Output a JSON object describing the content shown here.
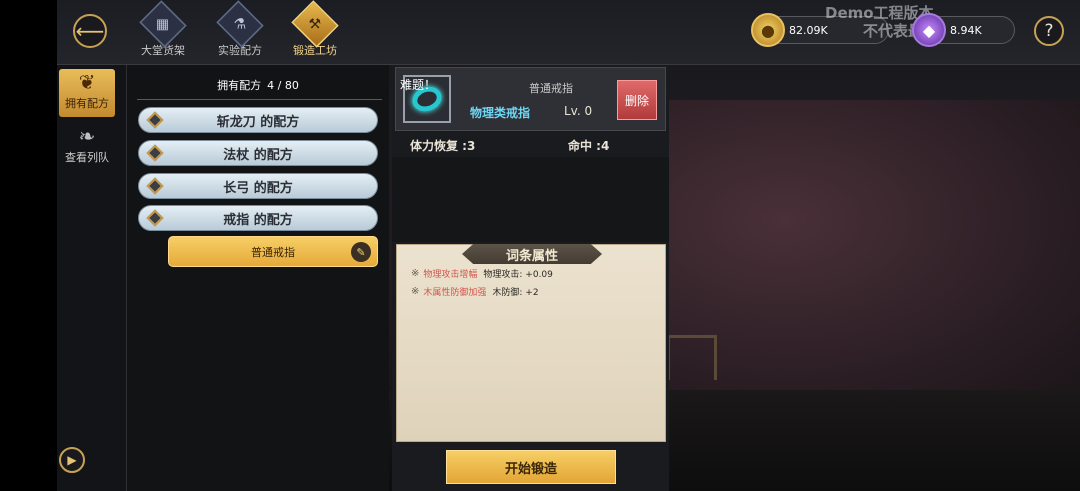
{
  "topbar": {
    "tabs": [
      {
        "label": "大堂货架",
        "icon": "shelf-icon"
      },
      {
        "label": "实验配方",
        "icon": "flask-icon"
      },
      {
        "label": "锻造工坊",
        "icon": "anvil-icon",
        "active": true
      }
    ],
    "watermark": {
      "line1": "Demo工程版本",
      "line2": "不代表最终品质"
    },
    "gold": {
      "value": "82.09K",
      "icon": "gold-coin-icon"
    },
    "gems": {
      "value": "8.94K",
      "icon": "purple-gem-icon"
    },
    "help": "?"
  },
  "sidenav": {
    "items": [
      {
        "label": "拥有配方",
        "icon": "recipe-scroll-icon",
        "active": true
      },
      {
        "label": "查看列队",
        "icon": "queue-icon"
      }
    ]
  },
  "recipes": {
    "count_label": "拥有配方",
    "count_value": "4 / 80",
    "list": [
      {
        "label": "斩龙刀 的配方"
      },
      {
        "label": "法杖 的配方"
      },
      {
        "label": "长弓 的配方"
      },
      {
        "label": "戒指 的配方"
      }
    ],
    "selected_sub": "普通戒指"
  },
  "detail": {
    "tag": "难题！",
    "name": "普通戒指",
    "type": "物理类戒指",
    "level": "Lv. 0",
    "delete_label": "删除",
    "stats": [
      {
        "label": "体力恢复 :3"
      },
      {
        "label": "命中 :4"
      }
    ]
  },
  "affix": {
    "title": "词条属性",
    "lines": [
      {
        "mark": "※",
        "name": "物理攻击增幅",
        "value": "物理攻击: +0.09"
      },
      {
        "mark": "※",
        "name": "木属性防御加强",
        "value": "木防御: +2"
      }
    ]
  },
  "forge_button": "开始锻造",
  "colors": {
    "accent": "#e9bd5a",
    "affix_name": "#d1564c",
    "item_type": "#6fd6f4"
  }
}
